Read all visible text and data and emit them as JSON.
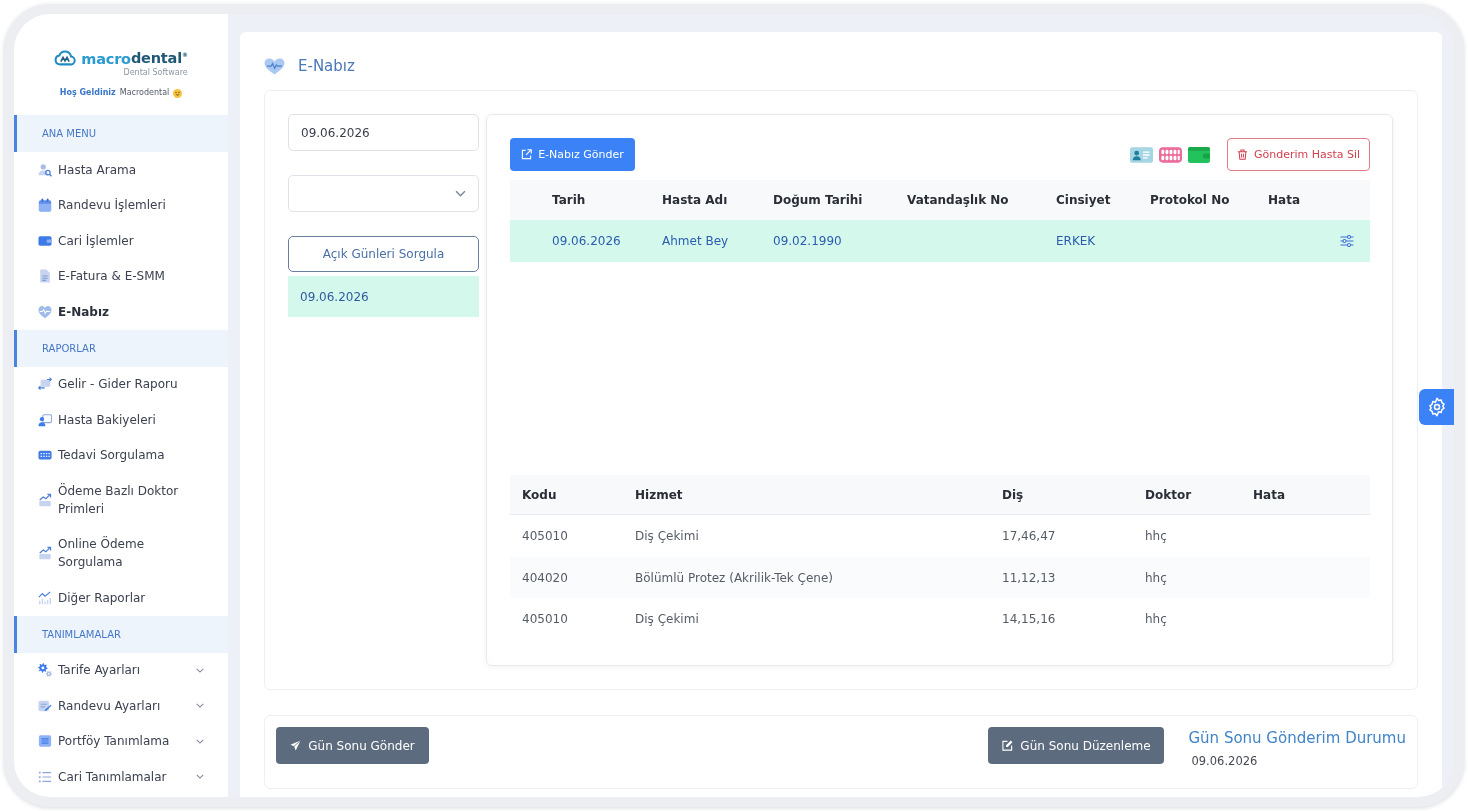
{
  "sidebar": {
    "logo": {
      "parts": [
        "macro",
        "dental$^{®}$"
      ],
      "tagline": "Dental Software"
    },
    "welcome": {
      "greeting": "Hoş Geldiniz",
      "user": "Macrodental"
    },
    "sections": [
      {
        "title": "ANA MENU",
        "items": [
          {
            "label": "Hasta Arama",
            "selected": false
          },
          {
            "label": "Randevu İşlemleri",
            "selected": false
          },
          {
            "label": "Cari İşlemler",
            "selected": false
          },
          {
            "label": "E-Fatura & E-SMM",
            "selected": false
          },
          {
            "label": "E-Nabız",
            "selected": true
          }
        ]
      },
      {
        "title": "RAPORLAR",
        "items": [
          {
            "label": "Gelir - Gider Raporu",
            "selected": false
          },
          {
            "label": "Hasta Bakiyeleri",
            "selected": false
          },
          {
            "label": "Tedavi Sorgulama",
            "selected": false
          },
          {
            "label": "Ödeme Bazlı Doktor Primleri",
            "selected": false
          },
          {
            "label": "Online Ödeme Sorgulama",
            "selected": false
          },
          {
            "label": "Diğer Raporlar",
            "selected": false
          }
        ]
      },
      {
        "title": "TANIMLAMALAR",
        "items": [
          {
            "label": "Tarife Ayarları",
            "selected": false,
            "expanded": false
          },
          {
            "label": "Randevu Ayarları",
            "selected": false,
            "expanded": false
          },
          {
            "label": "Portföy Tanımlama",
            "selected": false,
            "expanded": false
          },
          {
            "label": "Cari Tanımlamalar",
            "selected": false,
            "expanded": false
          }
        ]
      }
    ]
  },
  "page": {
    "title": "E-Nabız"
  },
  "filters": {
    "date_field": {
      "value": "09.06.2026"
    },
    "query_button": "Açık Günleri Sorgula",
    "open_days": [
      {
        "date": "09.06.2026",
        "selected": true
      }
    ]
  },
  "patients": {
    "send_button": "E-Nabız Gönder",
    "delete_button": "Gönderim Hasta Sil",
    "columns": [
      "Tarih",
      "Hasta Adı",
      "Doğum Tarihi",
      "Vatandaşlık No",
      "Cinsiyet",
      "Protokol No",
      "Hata"
    ],
    "rows": [
      {
        "selected": true,
        "cells": [
          "09.06.2026",
          "Ahmet Bey",
          "09.02.1990",
          null,
          "ERKEK",
          null,
          null
        ]
      }
    ]
  },
  "procedures": {
    "columns": [
      "Kodu",
      "Hizmet",
      "Diş",
      "Doktor",
      "Hata"
    ],
    "rows": [
      {
        "cells": [
          "405010",
          "Diş Çekimi",
          "17,46,47",
          "hhç"
        ]
      },
      {
        "cells": [
          "404020",
          "Bölümlü Protez (Akrilik-Tek Çene)",
          "11,12,13",
          "hhç"
        ]
      },
      {
        "cells": [
          "405010",
          "Diş Çekimi",
          "14,15,16",
          "hhç"
        ]
      }
    ]
  },
  "footer": {
    "send_button": "Gün Sonu Gönder",
    "edit_button": "Gün Sonu Düzenleme",
    "status": {
      "title": "Gün Sonu Gönderim Durumu",
      "date": "09.06.2026"
    }
  }
}
